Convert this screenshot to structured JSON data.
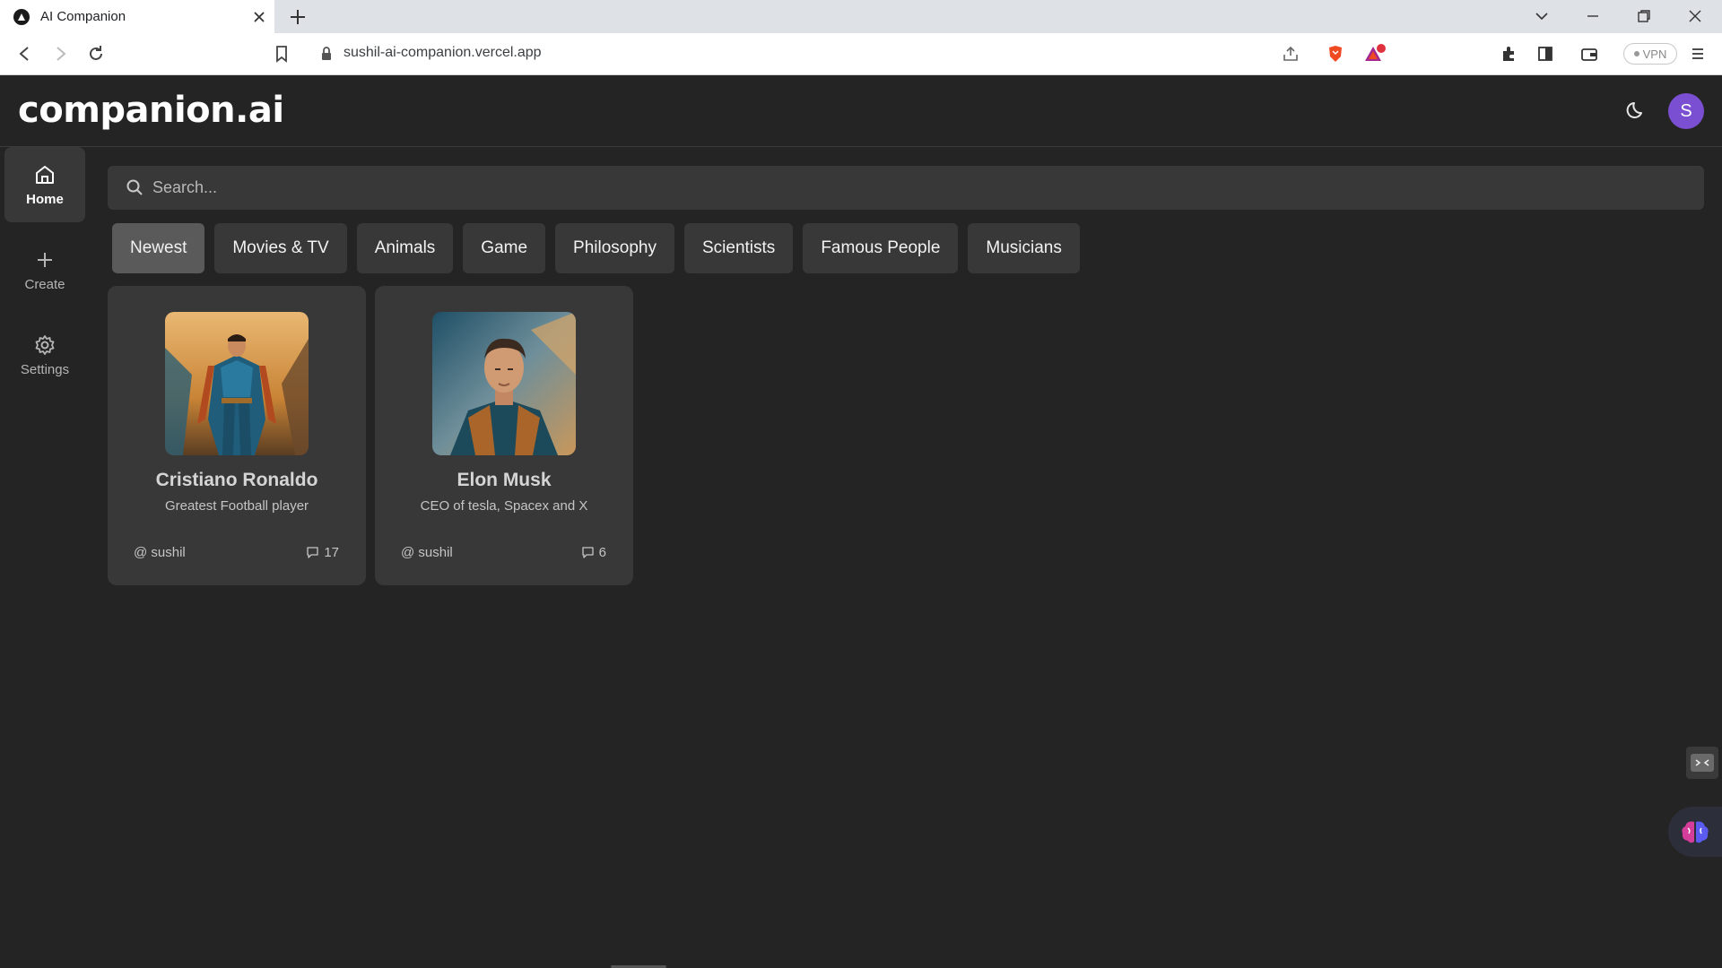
{
  "browser": {
    "tab_title": "AI Companion",
    "url": "sushil-ai-companion.vercel.app",
    "vpn_label": "VPN"
  },
  "app": {
    "logo": "companion.ai",
    "user_initial": "S"
  },
  "sidebar": {
    "items": [
      {
        "label": "Home",
        "icon": "home-icon",
        "active": true
      },
      {
        "label": "Create",
        "icon": "plus-icon",
        "active": false
      },
      {
        "label": "Settings",
        "icon": "gear-icon",
        "active": false
      }
    ]
  },
  "search": {
    "placeholder": "Search..."
  },
  "categories": [
    {
      "label": "Newest",
      "active": true
    },
    {
      "label": "Movies & TV",
      "active": false
    },
    {
      "label": "Animals",
      "active": false
    },
    {
      "label": "Game",
      "active": false
    },
    {
      "label": "Philosophy",
      "active": false
    },
    {
      "label": "Scientists",
      "active": false
    },
    {
      "label": "Famous People",
      "active": false
    },
    {
      "label": "Musicians",
      "active": false
    }
  ],
  "companions": [
    {
      "name": "Cristiano Ronaldo",
      "description": "Greatest Football player",
      "author": "@ sushil",
      "messages": "17"
    },
    {
      "name": "Elon Musk",
      "description": "CEO of tesla, Spacex and X",
      "author": "@ sushil",
      "messages": "6"
    }
  ],
  "colors": {
    "background": "#242424",
    "surface": "#383838",
    "avatar": "#7b4fd1"
  }
}
